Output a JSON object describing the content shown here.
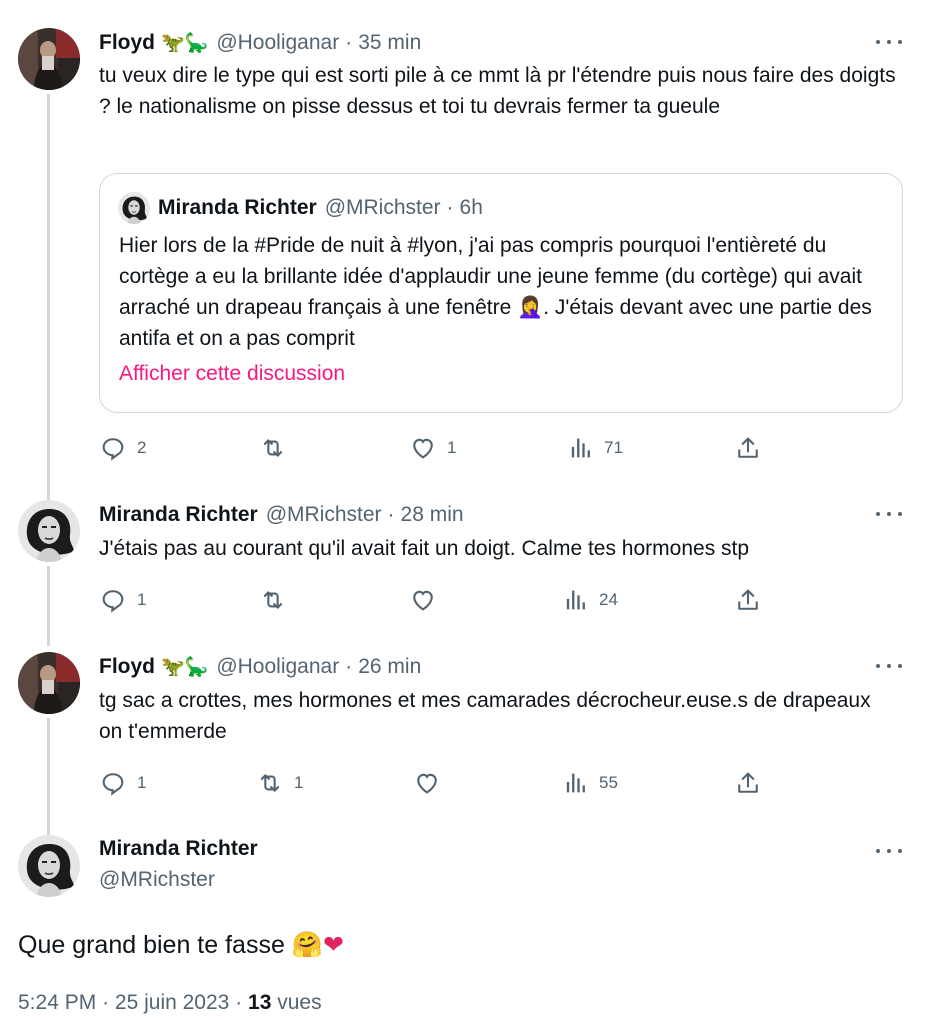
{
  "thread": [
    {
      "name": "Floyd",
      "emojis": "🦖🦕",
      "handle": "@Hooliganar",
      "time": "35 min",
      "text": "tu veux dire le type qui est sorti pile à ce mmt là pr l'étendre puis nous faire des doigts ? le nationalisme on pisse dessus et toi tu devrais fermer ta gueule",
      "quote": {
        "name": "Miranda Richter",
        "handle": "@MRichster",
        "time": "6h",
        "text": "Hier lors de la #Pride de nuit à #lyon, j'ai pas compris pourquoi l'entièreté du cortège a eu la brillante idée d'applaudir une jeune femme (du cortège) qui avait arraché un drapeau français à une fenêtre 🤦‍♀️. J'étais devant avec une partie des antifa et on a pas comprit",
        "link": "Afficher cette discussion"
      },
      "replies": "2",
      "retweets": "",
      "likes": "1",
      "views": "71"
    },
    {
      "name": "Miranda Richter",
      "handle": "@MRichster",
      "time": "28 min",
      "text": "J'étais pas au courant qu'il avait fait un doigt. Calme tes hormones stp",
      "replies": "1",
      "retweets": "",
      "likes": "",
      "views": "24"
    },
    {
      "name": "Floyd",
      "emojis": "🦖🦕",
      "handle": "@Hooliganar",
      "time": "26 min",
      "text": "tg sac a crottes, mes hormones et mes camarades décrocheur.euse.s de drapeaux on t'emmerde",
      "replies": "1",
      "retweets": "1",
      "likes": "",
      "views": "55"
    }
  ],
  "focal": {
    "name": "Miranda Richter",
    "handle": "@MRichster",
    "text": "Que grand bien te fasse",
    "emoji_hug": "🤗",
    "emoji_heart": "❤",
    "time": "5:24 PM",
    "date": "25 juin 2023",
    "views_count": "13",
    "views_label": "vues"
  },
  "sep": "·",
  "colors": {
    "accent": "#f91880",
    "muted": "#536471",
    "line": "#cfd9de"
  },
  "icons": [
    "reply-icon",
    "retweet-icon",
    "like-icon",
    "views-icon",
    "share-icon",
    "more-icon"
  ]
}
